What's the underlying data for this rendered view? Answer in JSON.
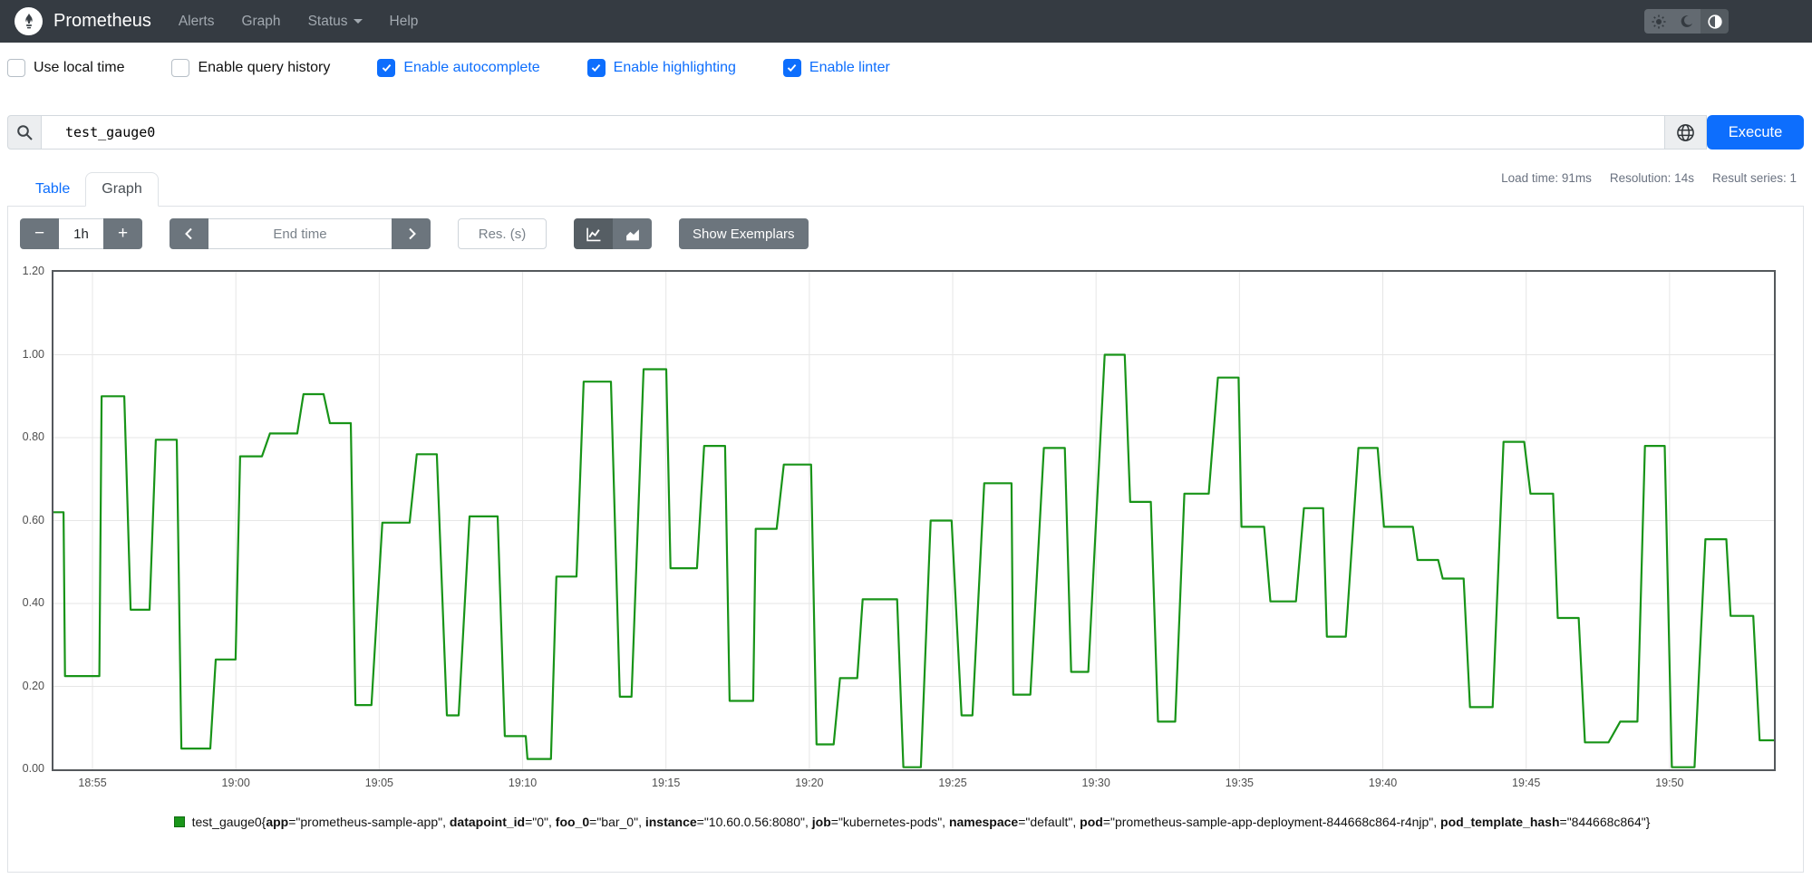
{
  "navbar": {
    "brand": "Prometheus",
    "items": [
      {
        "label": "Alerts",
        "caret": false
      },
      {
        "label": "Graph",
        "caret": false
      },
      {
        "label": "Status",
        "caret": true
      },
      {
        "label": "Help",
        "caret": false
      }
    ],
    "theme_icons": [
      "sun-icon",
      "moon-icon",
      "contrast-icon"
    ],
    "active_theme": "contrast-icon"
  },
  "options": [
    {
      "label": "Use local time",
      "checked": false
    },
    {
      "label": "Enable query history",
      "checked": false
    },
    {
      "label": "Enable autocomplete",
      "checked": true
    },
    {
      "label": "Enable highlighting",
      "checked": true
    },
    {
      "label": "Enable linter",
      "checked": true
    }
  ],
  "query": {
    "value": "test_gauge0",
    "execute_label": "Execute"
  },
  "tabs": {
    "table": "Table",
    "graph": "Graph",
    "active": "Graph"
  },
  "stats": {
    "load_time": "Load time: 91ms",
    "resolution": "Resolution: 14s",
    "result_series": "Result series: 1"
  },
  "toolbar": {
    "minus": "−",
    "plus": "+",
    "range_value": "1h",
    "end_time_placeholder": "End time",
    "res_placeholder": "Res. (s)",
    "show_exemplars": "Show Exemplars"
  },
  "colors": {
    "primary": "#0d6efd",
    "secondary": "#6c757d",
    "navbar_bg": "#353b42",
    "series_green": "#189418",
    "grid": "#e6e6e6",
    "plot_border": "#54585c"
  },
  "chart_data": {
    "type": "line",
    "title": "",
    "xlabel": "",
    "ylabel": "",
    "ylim": [
      0,
      1.2
    ],
    "xlim_minutes": [
      0,
      60
    ],
    "grid": true,
    "legend_position": "bottom-center",
    "y_ticks": [
      "0.00",
      "0.20",
      "0.40",
      "0.60",
      "0.80",
      "1.00",
      "1.20"
    ],
    "x_ticks": [
      {
        "t": 1.36,
        "label": "18:55"
      },
      {
        "t": 6.36,
        "label": "19:00"
      },
      {
        "t": 11.36,
        "label": "19:05"
      },
      {
        "t": 16.36,
        "label": "19:10"
      },
      {
        "t": 21.36,
        "label": "19:15"
      },
      {
        "t": 26.36,
        "label": "19:20"
      },
      {
        "t": 31.36,
        "label": "19:25"
      },
      {
        "t": 36.36,
        "label": "19:30"
      },
      {
        "t": 41.36,
        "label": "19:35"
      },
      {
        "t": 46.36,
        "label": "19:40"
      },
      {
        "t": 51.36,
        "label": "19:45"
      },
      {
        "t": 56.36,
        "label": "19:50"
      }
    ],
    "series": [
      {
        "name": "test_gauge0",
        "color": "#189418",
        "points": [
          [
            0,
            0.62
          ],
          [
            0.35,
            0.62
          ],
          [
            0.4,
            0.225
          ],
          [
            1.6,
            0.225
          ],
          [
            1.68,
            0.9
          ],
          [
            2.47,
            0.9
          ],
          [
            2.69,
            0.385
          ],
          [
            3.35,
            0.385
          ],
          [
            3.57,
            0.795
          ],
          [
            4.3,
            0.795
          ],
          [
            4.46,
            0.05
          ],
          [
            5.47,
            0.05
          ],
          [
            5.66,
            0.265
          ],
          [
            6.35,
            0.265
          ],
          [
            6.51,
            0.755
          ],
          [
            7.27,
            0.755
          ],
          [
            7.55,
            0.81
          ],
          [
            8.5,
            0.81
          ],
          [
            8.72,
            0.905
          ],
          [
            9.42,
            0.905
          ],
          [
            9.64,
            0.835
          ],
          [
            10.37,
            0.835
          ],
          [
            10.53,
            0.155
          ],
          [
            11.09,
            0.155
          ],
          [
            11.47,
            0.595
          ],
          [
            12.42,
            0.595
          ],
          [
            12.67,
            0.76
          ],
          [
            13.37,
            0.76
          ],
          [
            13.72,
            0.13
          ],
          [
            14.13,
            0.13
          ],
          [
            14.51,
            0.61
          ],
          [
            15.49,
            0.61
          ],
          [
            15.74,
            0.08
          ],
          [
            16.47,
            0.08
          ],
          [
            16.53,
            0.025
          ],
          [
            17.35,
            0.025
          ],
          [
            17.54,
            0.465
          ],
          [
            18.24,
            0.465
          ],
          [
            18.49,
            0.935
          ],
          [
            19.44,
            0.935
          ],
          [
            19.75,
            0.175
          ],
          [
            20.16,
            0.175
          ],
          [
            20.58,
            0.965
          ],
          [
            21.37,
            0.965
          ],
          [
            21.52,
            0.485
          ],
          [
            22.44,
            0.485
          ],
          [
            22.69,
            0.78
          ],
          [
            23.42,
            0.78
          ],
          [
            23.58,
            0.165
          ],
          [
            24.4,
            0.165
          ],
          [
            24.49,
            0.58
          ],
          [
            25.22,
            0.58
          ],
          [
            25.47,
            0.735
          ],
          [
            26.42,
            0.735
          ],
          [
            26.61,
            0.06
          ],
          [
            27.21,
            0.06
          ],
          [
            27.43,
            0.22
          ],
          [
            28.03,
            0.22
          ],
          [
            28.22,
            0.41
          ],
          [
            29.42,
            0.41
          ],
          [
            29.64,
            0.005
          ],
          [
            30.25,
            0.005
          ],
          [
            30.59,
            0.6
          ],
          [
            31.32,
            0.6
          ],
          [
            31.67,
            0.13
          ],
          [
            32.05,
            0.13
          ],
          [
            32.46,
            0.69
          ],
          [
            33.41,
            0.69
          ],
          [
            33.47,
            0.18
          ],
          [
            34.07,
            0.18
          ],
          [
            34.54,
            0.775
          ],
          [
            35.27,
            0.775
          ],
          [
            35.49,
            0.235
          ],
          [
            36.09,
            0.235
          ],
          [
            36.66,
            1.0
          ],
          [
            37.36,
            1.0
          ],
          [
            37.55,
            0.645
          ],
          [
            38.27,
            0.645
          ],
          [
            38.52,
            0.115
          ],
          [
            39.12,
            0.115
          ],
          [
            39.44,
            0.665
          ],
          [
            40.29,
            0.665
          ],
          [
            40.61,
            0.945
          ],
          [
            41.33,
            0.945
          ],
          [
            41.43,
            0.585
          ],
          [
            42.22,
            0.585
          ],
          [
            42.44,
            0.405
          ],
          [
            43.33,
            0.405
          ],
          [
            43.61,
            0.63
          ],
          [
            44.28,
            0.63
          ],
          [
            44.41,
            0.32
          ],
          [
            45.07,
            0.32
          ],
          [
            45.51,
            0.775
          ],
          [
            46.18,
            0.775
          ],
          [
            46.4,
            0.585
          ],
          [
            47.41,
            0.585
          ],
          [
            47.57,
            0.505
          ],
          [
            48.29,
            0.505
          ],
          [
            48.45,
            0.46
          ],
          [
            49.18,
            0.46
          ],
          [
            49.4,
            0.15
          ],
          [
            50.19,
            0.15
          ],
          [
            50.57,
            0.79
          ],
          [
            51.29,
            0.79
          ],
          [
            51.51,
            0.665
          ],
          [
            52.3,
            0.665
          ],
          [
            52.46,
            0.365
          ],
          [
            53.19,
            0.365
          ],
          [
            53.41,
            0.065
          ],
          [
            54.23,
            0.065
          ],
          [
            54.64,
            0.115
          ],
          [
            55.24,
            0.115
          ],
          [
            55.5,
            0.78
          ],
          [
            56.19,
            0.78
          ],
          [
            56.44,
            0.005
          ],
          [
            57.23,
            0.005
          ],
          [
            57.61,
            0.555
          ],
          [
            58.34,
            0.555
          ],
          [
            58.49,
            0.37
          ],
          [
            59.28,
            0.37
          ],
          [
            59.5,
            0.07
          ],
          [
            60,
            0.07
          ]
        ]
      }
    ]
  },
  "legend": {
    "name": "test_gauge0",
    "labels": [
      {
        "key": "app",
        "value": "prometheus-sample-app"
      },
      {
        "key": "datapoint_id",
        "value": "0"
      },
      {
        "key": "foo_0",
        "value": "bar_0"
      },
      {
        "key": "instance",
        "value": "10.60.0.56:8080"
      },
      {
        "key": "job",
        "value": "kubernetes-pods"
      },
      {
        "key": "namespace",
        "value": "default"
      },
      {
        "key": "pod",
        "value": "prometheus-sample-app-deployment-844668c864-r4njp"
      },
      {
        "key": "pod_template_hash",
        "value": "844668c864"
      }
    ]
  }
}
